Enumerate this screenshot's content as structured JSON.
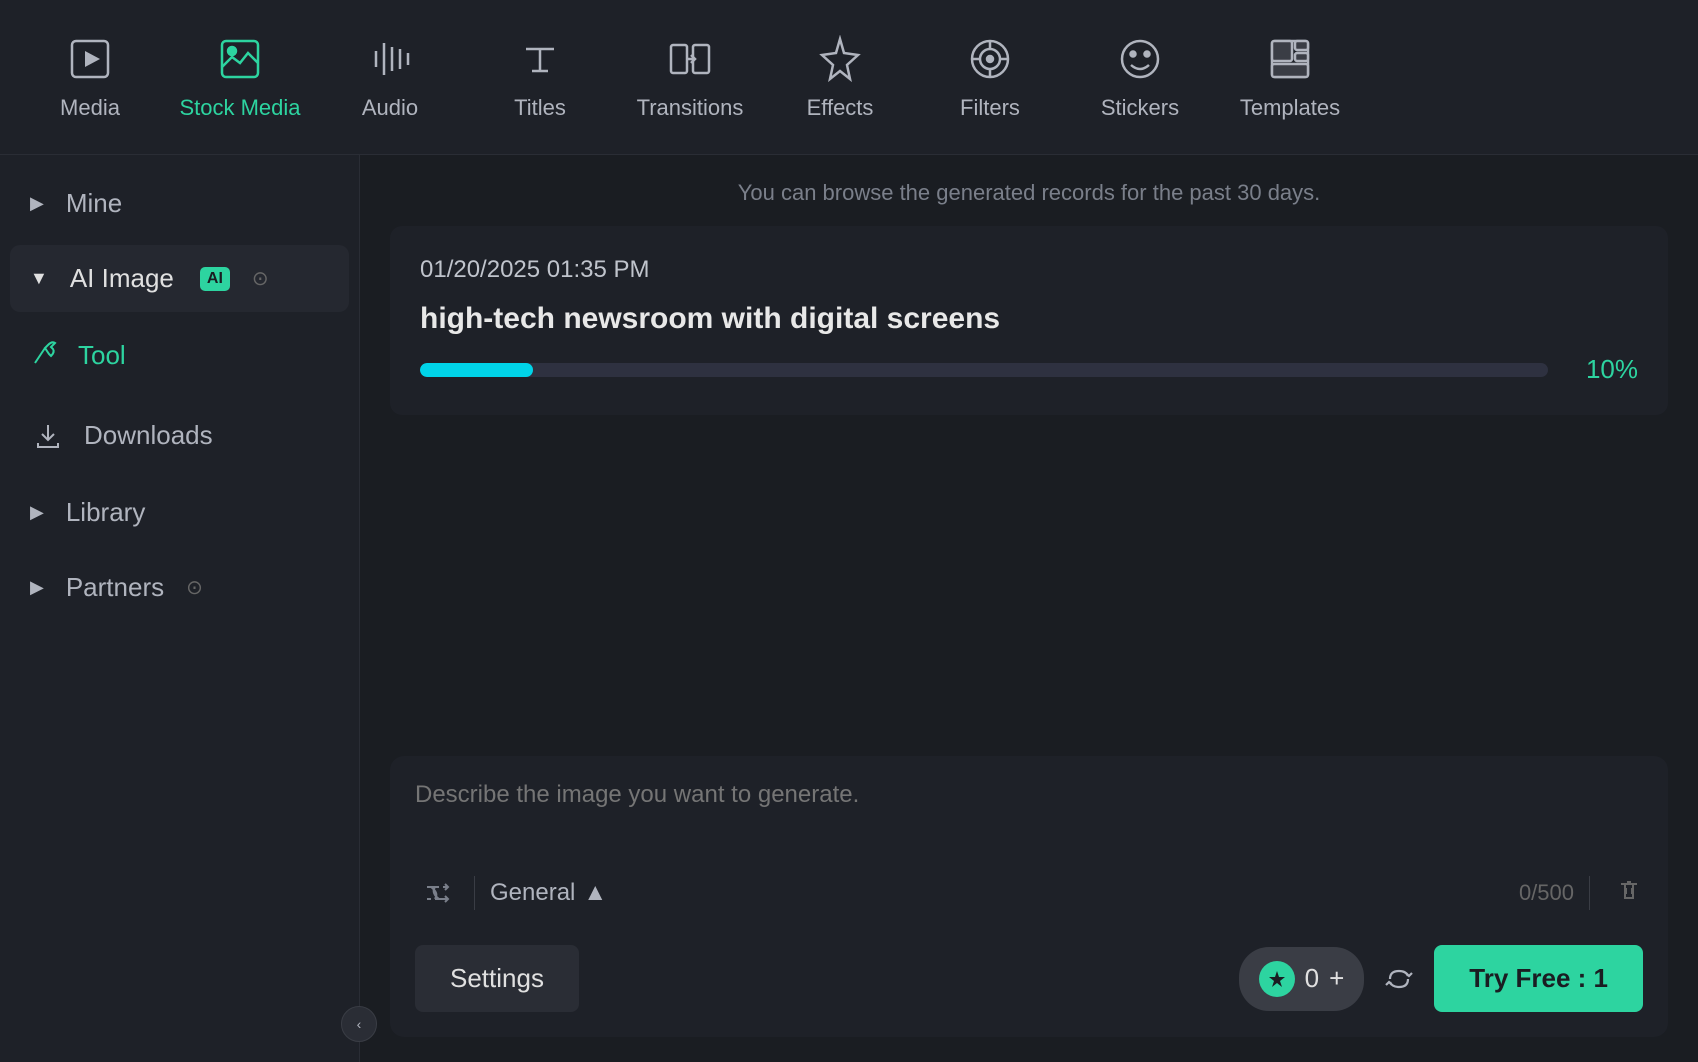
{
  "nav": {
    "items": [
      {
        "id": "media",
        "label": "Media",
        "active": false
      },
      {
        "id": "stock-media",
        "label": "Stock Media",
        "active": true
      },
      {
        "id": "audio",
        "label": "Audio",
        "active": false
      },
      {
        "id": "titles",
        "label": "Titles",
        "active": false
      },
      {
        "id": "transitions",
        "label": "Transitions",
        "active": false
      },
      {
        "id": "effects",
        "label": "Effects",
        "active": false
      },
      {
        "id": "filters",
        "label": "Filters",
        "active": false
      },
      {
        "id": "stickers",
        "label": "Stickers",
        "active": false
      },
      {
        "id": "templates",
        "label": "Templates",
        "active": false
      }
    ]
  },
  "sidebar": {
    "mine_label": "Mine",
    "ai_image_label": "AI Image",
    "ai_badge": "AI",
    "tool_label": "Tool",
    "downloads_label": "Downloads",
    "library_label": "Library",
    "partners_label": "Partners",
    "collapse_label": "<"
  },
  "main": {
    "info_text": "You can browse the generated records for the past 30 days.",
    "generation": {
      "timestamp": "01/20/2025 01:35 PM",
      "prompt": "high-tech newsroom with digital screens",
      "progress": 10,
      "progress_label": "10%"
    },
    "prompt_placeholder": "Describe the image you want to generate.",
    "style_label": "General",
    "char_count": "0/500",
    "settings_label": "Settings",
    "credits_count": "0",
    "try_free_label": "Try Free : 1"
  }
}
